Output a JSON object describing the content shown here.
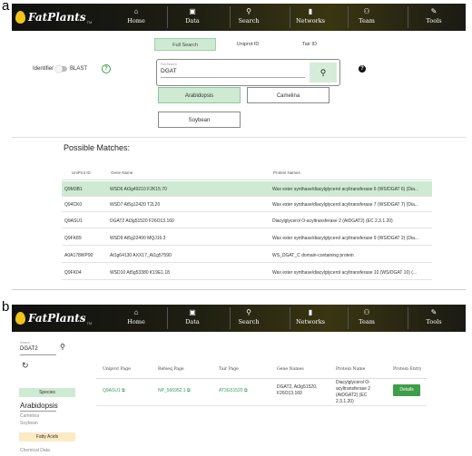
{
  "panels": {
    "a": "a",
    "b": "b"
  },
  "app": {
    "logo": "FatPlants",
    "tm": "TM"
  },
  "nav": [
    {
      "icon": "⌂",
      "label": "Home",
      "icon_name": "home-icon"
    },
    {
      "icon": "▣",
      "label": "Data",
      "icon_name": "data-icon"
    },
    {
      "icon": "⚲",
      "label": "Search",
      "icon_name": "search-icon"
    },
    {
      "icon": "▮",
      "label": "Networks",
      "icon_name": "networks-icon"
    },
    {
      "icon": "⚇",
      "label": "Team",
      "icon_name": "team-icon"
    },
    {
      "icon": "✎",
      "label": "Tools",
      "icon_name": "tools-icon"
    }
  ],
  "panel_a": {
    "tabs": [
      "Full Search",
      "Uniprot ID",
      "Tair ID"
    ],
    "identifier_label": "Identifier",
    "blast_label": "BLAST",
    "help": "?",
    "search": {
      "label": "Full Search",
      "value": "DGAT",
      "button_icon": "⚲"
    },
    "organisms": [
      "Arabidopsis",
      "Camelina",
      "Soybean"
    ],
    "possible_matches": "Possible Matches:",
    "columns": [
      "UniProt ID",
      "Gene Name",
      "Protein Names"
    ],
    "rows": [
      {
        "id": "Q9M3B1",
        "gene": "WSD6 At3g49210 F2K15.70",
        "protein": "Wax ester synthase/diacylglycerol acyltransferase 6 (WS/DGAT 6) (Dia..."
      },
      {
        "id": "Q94CK0",
        "gene": "WSD7 At5g12420 T2L20",
        "protein": "Wax ester synthase/diacylglycerol acyltransferase 7 (WS/DGAT 7) (Dia..."
      },
      {
        "id": "Q9ASU1",
        "gene": "DGAT2 At3g51520 F26O13.160",
        "protein": "Diacylglycerol O-acyltransferase 2 (AtDGAT2) (EC 2.3.1.20)"
      },
      {
        "id": "Q9FK89",
        "gene": "WSD9 At5g22490 MQJ16.3",
        "protein": "Wax ester synthase/diacylglycerol acyltransferase 9 (WS/DGAT 2) (Dia..."
      },
      {
        "id": "A0A178WP90",
        "gene": "At1g64130 AXX17_At1g57590",
        "protein": "WS_DGAT_C domain-containing protein"
      },
      {
        "id": "Q9FK04",
        "gene": "WSD10 At5g53380 K19E1.18",
        "protein": "Wax ester synthase/diacylglycerol acyltransferase 10 (WS/DGAT 10) (..."
      }
    ]
  },
  "panel_b": {
    "search": {
      "label": "Search",
      "value": "DGAT2",
      "icon": "⚲"
    },
    "refresh_icon": "↻",
    "sidebar": {
      "species_label": "Species",
      "species_selected": "Arabidopsis",
      "species_options": [
        "Camelina",
        "Soybean"
      ],
      "fatty_acids_label": "Fatty Acids",
      "chemical_data": "Chemical Data"
    },
    "columns": [
      "Uniprot Page",
      "Refseq Page",
      "Tair Page",
      "Gene Names",
      "Protein Name",
      "Protein Entry"
    ],
    "row": {
      "uniprot": "Q9ASU1",
      "refseq": "NP_566952.1",
      "tair": "AT3G51520",
      "gene_names": [
        "DGAT2, At3g51520,",
        "F26O13.160"
      ],
      "protein_name": [
        "Diacylglycerol O-",
        "acyltransferase 2",
        "(AtDGAT2) (EC",
        "2.3.1.20)"
      ],
      "details": "Details",
      "ext_icon": "⧉"
    }
  },
  "colors": {
    "accent_green": "#3e9e4a",
    "highlight": "#cfead2",
    "nav_bg": "#1e1e12"
  }
}
